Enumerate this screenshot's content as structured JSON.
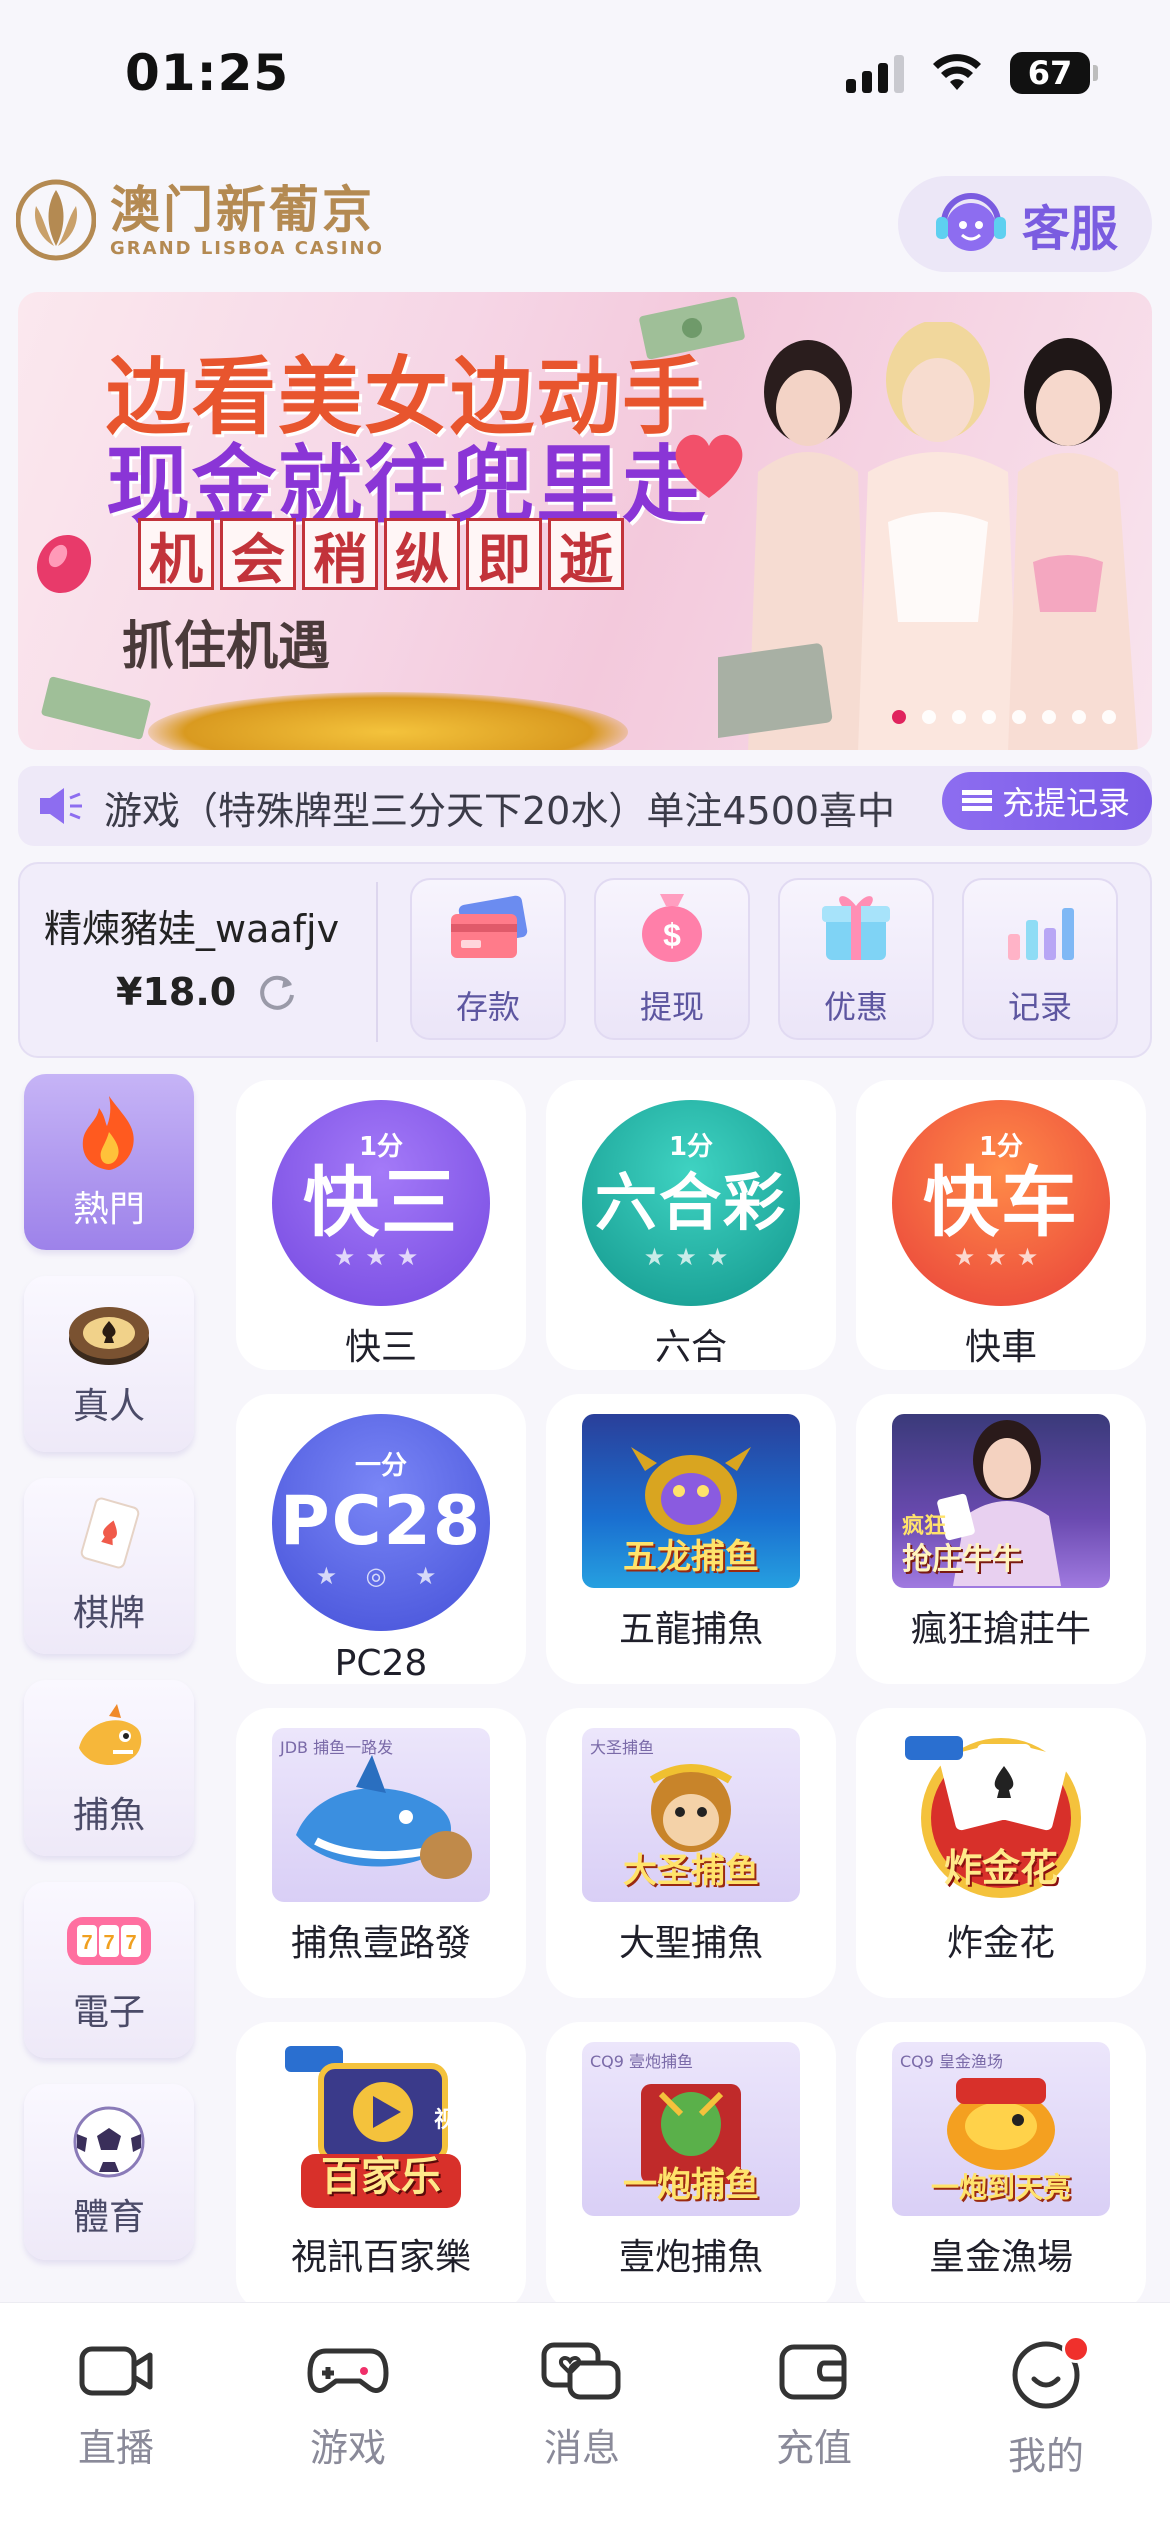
{
  "status": {
    "time": "01:25",
    "battery": "67"
  },
  "header": {
    "logo_cn": "澳门新葡京",
    "logo_en": "GRAND LISBOA CASINO",
    "service_label": "客服"
  },
  "banner": {
    "line1": "边看美女边动手",
    "line2": "现金就往兜里走",
    "chips": [
      "机",
      "会",
      "稍",
      "纵",
      "即",
      "逝"
    ],
    "line4": "抓住机遇",
    "slide_count": 8,
    "active_slide": 1
  },
  "marquee": {
    "text": "游戏（特殊牌型三分天下20水）单注4500喜中",
    "record_label": "充提记录"
  },
  "account": {
    "username": "精煉豬娃_waafjv",
    "balance": "¥18.0",
    "actions": [
      {
        "label": "存款",
        "icon": "card-icon"
      },
      {
        "label": "提现",
        "icon": "money-bag-icon"
      },
      {
        "label": "优惠",
        "icon": "gift-icon"
      },
      {
        "label": "记录",
        "icon": "bar-chart-icon"
      }
    ]
  },
  "categories": [
    {
      "label": "熱門",
      "icon": "fire-icon",
      "active": true
    },
    {
      "label": "真人",
      "icon": "poker-chip-icon",
      "active": false
    },
    {
      "label": "棋牌",
      "icon": "playing-card-icon",
      "active": false
    },
    {
      "label": "捕魚",
      "icon": "fish-icon",
      "active": false
    },
    {
      "label": "電子",
      "icon": "slot-machine-icon",
      "active": false
    },
    {
      "label": "體育",
      "icon": "soccer-ball-icon",
      "active": false
    }
  ],
  "games": [
    {
      "label": "快三",
      "badge": "1分",
      "title": "快三"
    },
    {
      "label": "六合",
      "badge": "1分",
      "title": "六合彩"
    },
    {
      "label": "快車",
      "badge": "1分",
      "title": "快车"
    },
    {
      "label": "PC28",
      "badge": "一分",
      "title": "PC28"
    },
    {
      "label": "五龍捕魚",
      "caption": "五龙捕鱼"
    },
    {
      "label": "瘋狂搶莊牛",
      "caption": "抢庄牛牛",
      "subcaption": "疯狂"
    },
    {
      "label": "捕魚壹路發",
      "tag": "JDB 捕鱼一路发"
    },
    {
      "label": "大聖捕魚",
      "tag": "大圣捕鱼",
      "caption": "大圣捕鱼"
    },
    {
      "label": "炸金花",
      "caption": "炸金花"
    },
    {
      "label": "視訊百家樂",
      "caption": "百家乐",
      "subcaption": "视讯"
    },
    {
      "label": "壹炮捕魚",
      "tag": "CQ9 壹炮捕鱼",
      "caption": "一炮捕鱼"
    },
    {
      "label": "皇金漁場",
      "tag": "CQ9 皇金渔场",
      "caption": "一炮到天亮"
    }
  ],
  "tabs": [
    {
      "label": "直播",
      "icon": "camera-icon"
    },
    {
      "label": "游戏",
      "icon": "gamepad-icon"
    },
    {
      "label": "消息",
      "icon": "chat-icon"
    },
    {
      "label": "充值",
      "icon": "wallet-icon"
    },
    {
      "label": "我的",
      "icon": "profile-icon",
      "badge": true
    }
  ],
  "colors": {
    "accent": "#7a5ce0",
    "kuaisan": "#8a5cf0",
    "liuhe": "#1fb3a6",
    "kuaiche": "#f05a3a",
    "pc28": "#5a62e6",
    "badge": "#f0302c"
  }
}
